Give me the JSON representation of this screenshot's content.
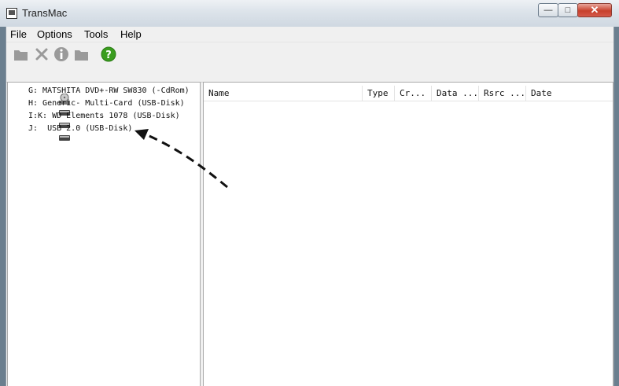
{
  "window": {
    "title": "TransMac"
  },
  "menu": [
    "File",
    "Options",
    "Tools",
    "Help"
  ],
  "toolbar": [
    {
      "name": "open-icon"
    },
    {
      "name": "delete-icon"
    },
    {
      "name": "info-icon"
    },
    {
      "name": "folder-icon"
    },
    {
      "name": "help-icon"
    }
  ],
  "drives": [
    {
      "label": "G: MATSHITA DVD+-RW SW830 (-CdRom)",
      "icon": "cdrom-icon"
    },
    {
      "label": "H: Generic- Multi-Card (USB-Disk)",
      "icon": "disk-icon"
    },
    {
      "label": "I:K: WD Elements 1078 (USB-Disk)",
      "icon": "disk-icon"
    },
    {
      "label": "J:  USB 2.0 (USB-Disk)",
      "icon": "disk-icon"
    }
  ],
  "columns": [
    "Name",
    "Type",
    "Cr...",
    "Data ...",
    "Rsrc ...",
    "Date"
  ],
  "colors": {
    "help_green": "#3a9d1f",
    "close_red": "#c7402c"
  }
}
